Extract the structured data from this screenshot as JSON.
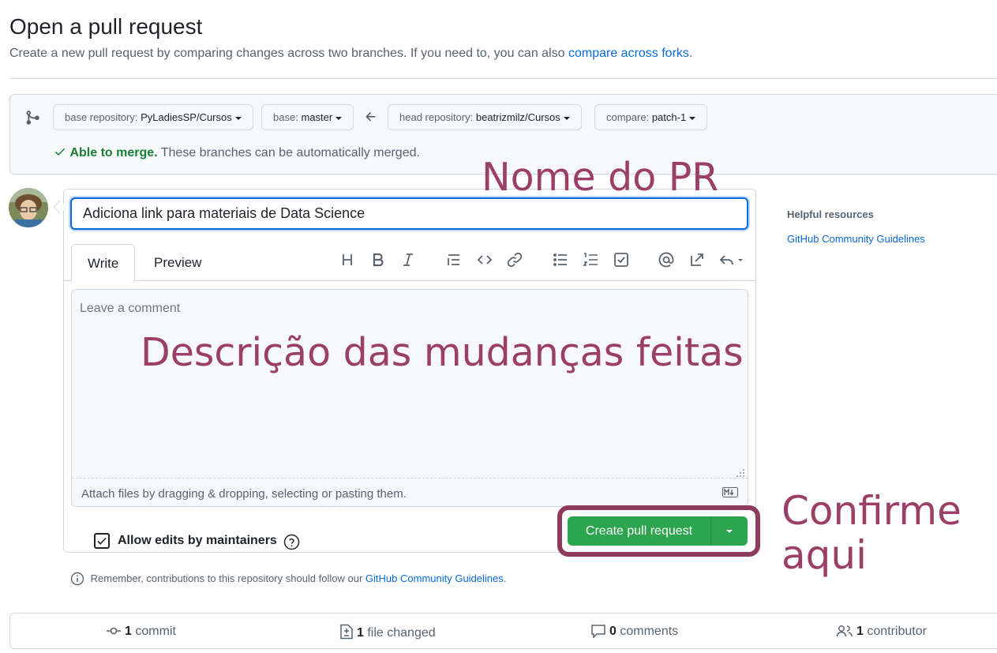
{
  "header": {
    "title": "Open a pull request",
    "subtitle_text": "Create a new pull request by comparing changes across two branches. If you need to, you can also",
    "subtitle_link": "compare across forks",
    "subtitle_end": "."
  },
  "range": {
    "base_repo_label": "base repository:",
    "base_repo_value": "PyLadiesSP/Cursos",
    "base_label": "base:",
    "base_value": "master",
    "head_repo_label": "head repository:",
    "head_repo_value": "beatrizmilz/Cursos",
    "compare_label": "compare:",
    "compare_value": "patch-1",
    "merge_ok": "Able to merge.",
    "merge_text": "These branches can be automatically merged."
  },
  "form": {
    "title_value": "Adiciona link para materiais de Data Science",
    "tabs": [
      "Write",
      "Preview"
    ],
    "comment_placeholder": "Leave a comment",
    "attach_text": "Attach files by dragging & dropping, selecting or pasting them.",
    "allow_edits_label": "Allow edits by maintainers",
    "allow_edits_checked": true,
    "create_button": "Create pull request"
  },
  "toolbar_icons": [
    "heading-icon",
    "bold-icon",
    "italic-icon",
    "quote-icon",
    "code-icon",
    "link-icon",
    "unordered-list-icon",
    "ordered-list-icon",
    "task-list-icon",
    "mention-icon",
    "cross-reference-icon",
    "reply-icon"
  ],
  "annotations": {
    "title_note": "Nome do PR",
    "description_note": "Descrição das mudanças feitas",
    "confirm_note_1": "Confirme",
    "confirm_note_2": "aqui",
    "color": "#9c3f66"
  },
  "sidebar": {
    "heading": "Helpful resources",
    "link": "GitHub Community Guidelines"
  },
  "footer": {
    "remember_text": "Remember, contributions to this repository should follow our",
    "remember_link": "GitHub Community Guidelines",
    "remember_end": "."
  },
  "stats": {
    "commits_count": "1",
    "commits_label": "commit",
    "files_count": "1",
    "files_label": "file changed",
    "comments_count": "0",
    "comments_label": "comments",
    "contributors_count": "1",
    "contributors_label": "contributor"
  },
  "colors": {
    "accent": "#0969da",
    "success": "#1a7f37",
    "button": "#2da44e",
    "highlight_border": "#8e3a5c"
  }
}
